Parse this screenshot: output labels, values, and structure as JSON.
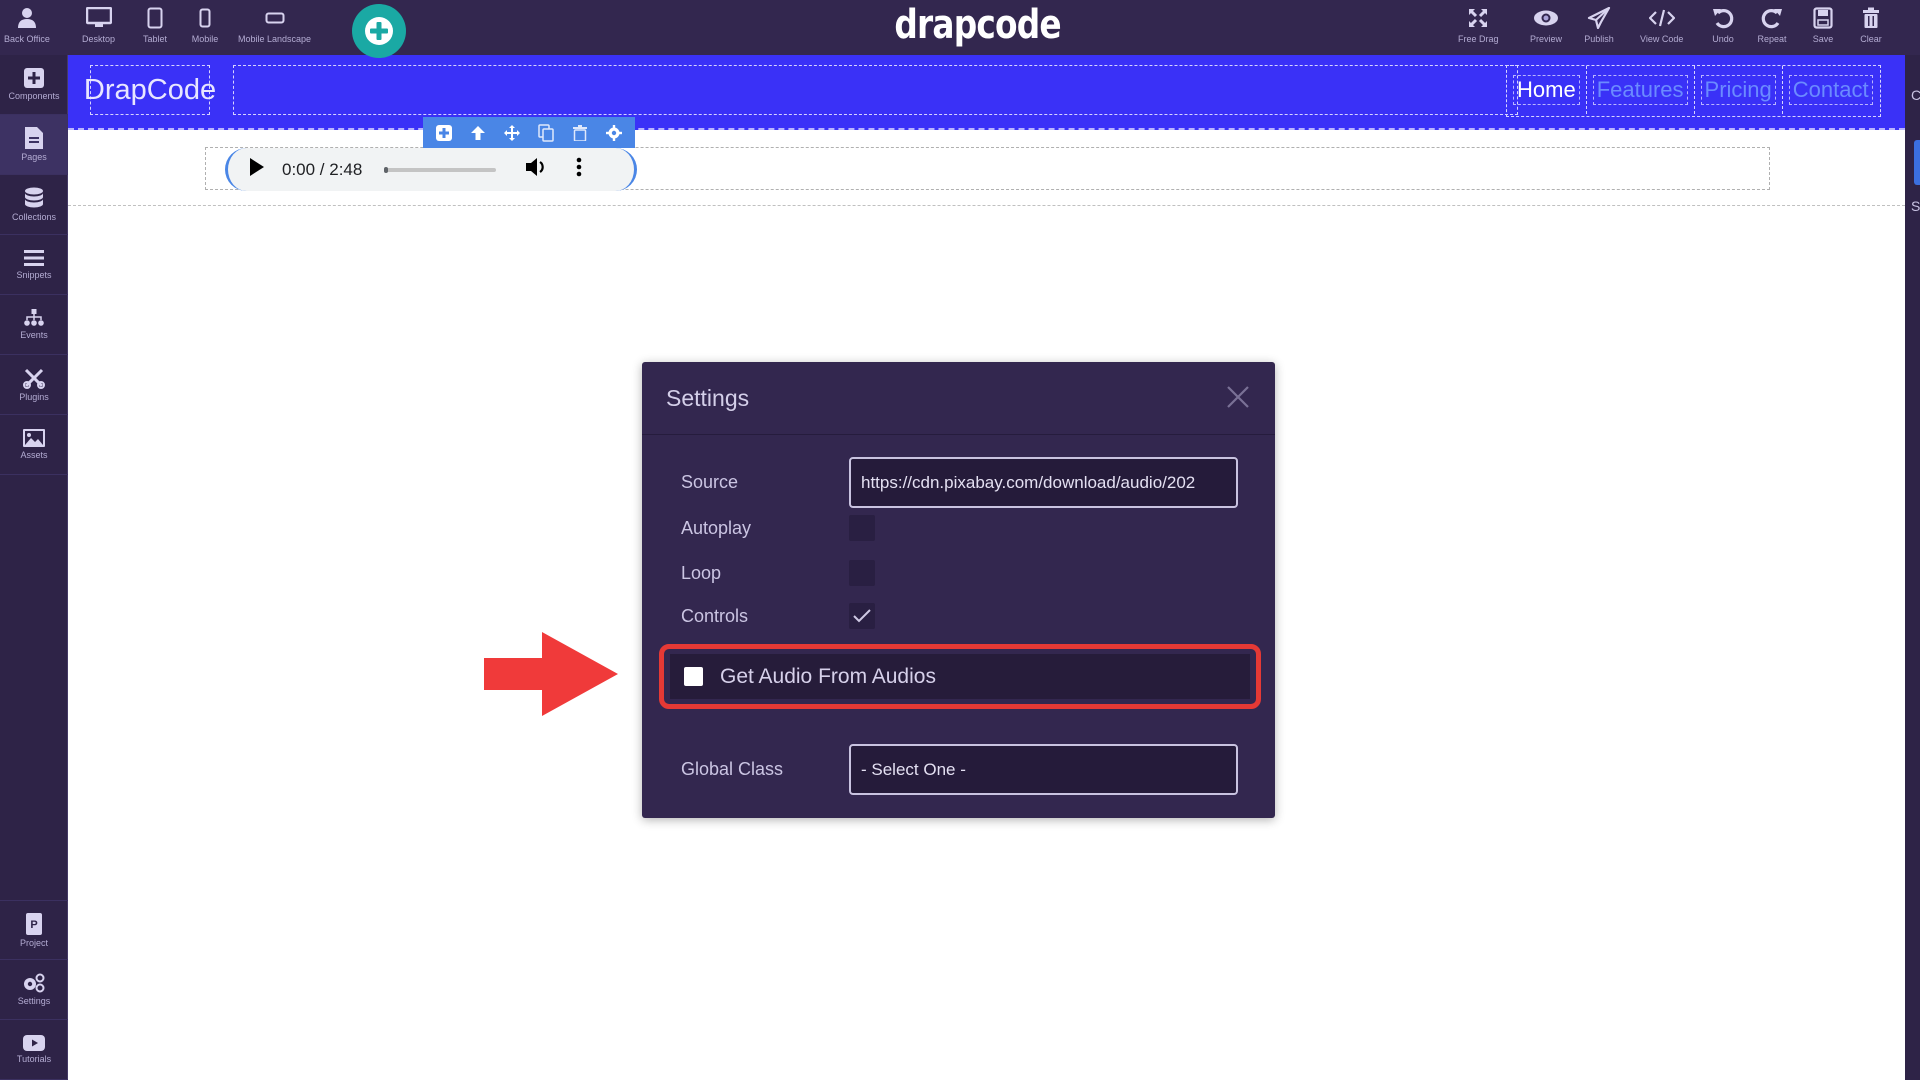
{
  "topbar": {
    "left_items": [
      {
        "label": "Back Office",
        "icon": "user-icon"
      },
      {
        "label": "Desktop",
        "icon": "desktop-icon"
      },
      {
        "label": "Tablet",
        "icon": "tablet-icon"
      },
      {
        "label": "Mobile",
        "icon": "mobile-icon"
      },
      {
        "label": "Mobile Landscape",
        "icon": "mobile-landscape-icon"
      }
    ],
    "brand": "drapcode",
    "right_items": [
      {
        "label": "Free Drag",
        "icon": "free-drag-icon"
      },
      {
        "label": "Preview",
        "icon": "eye-icon"
      },
      {
        "label": "Publish",
        "icon": "paper-plane-icon"
      },
      {
        "label": "View Code",
        "icon": "code-icon"
      },
      {
        "label": "Undo",
        "icon": "undo-icon"
      },
      {
        "label": "Repeat",
        "icon": "redo-icon"
      },
      {
        "label": "Save",
        "icon": "save-icon"
      },
      {
        "label": "Clear",
        "icon": "trash-icon"
      }
    ]
  },
  "sidebar": {
    "items": [
      {
        "label": "Components",
        "icon": "plus-square-icon"
      },
      {
        "label": "Pages",
        "icon": "file-icon",
        "active": true
      },
      {
        "label": "Collections",
        "icon": "database-icon"
      },
      {
        "label": "Snippets",
        "icon": "list-icon"
      },
      {
        "label": "Events",
        "icon": "sitemap-icon"
      },
      {
        "label": "Plugins",
        "icon": "tools-icon"
      },
      {
        "label": "Assets",
        "icon": "image-icon"
      }
    ],
    "bottom_items": [
      {
        "label": "Project",
        "icon": "project-icon"
      },
      {
        "label": "Settings",
        "icon": "cogs-icon"
      },
      {
        "label": "Tutorials",
        "icon": "youtube-icon"
      }
    ]
  },
  "canvas": {
    "site_logo": "DrapCode",
    "nav_links": [
      "Home",
      "Features",
      "Pricing",
      "Contact"
    ],
    "audio_player": {
      "current_time": "0:00",
      "duration": "2:48",
      "time_text": "0:00 / 2:48",
      "progress": 0.0
    }
  },
  "modal": {
    "title": "Settings",
    "source_label": "Source",
    "source_value": "https://cdn.pixabay.com/download/audio/202",
    "autoplay_label": "Autoplay",
    "autoplay_checked": false,
    "loop_label": "Loop",
    "loop_checked": false,
    "controls_label": "Controls",
    "controls_checked": true,
    "get_audio_label": "Get Audio From Audios",
    "get_audio_checked": false,
    "global_class_label": "Global Class",
    "global_class_value": "- Select One -"
  },
  "colors": {
    "topbar_bg": "#33274f",
    "site_header_bg": "#3a31f7",
    "fab": "#1aa9a4",
    "element_toolbar": "#4a86e6",
    "highlight": "#e53935",
    "arrow": "#f03a3a"
  },
  "right_panel": {
    "letters": [
      "C",
      "S"
    ]
  }
}
